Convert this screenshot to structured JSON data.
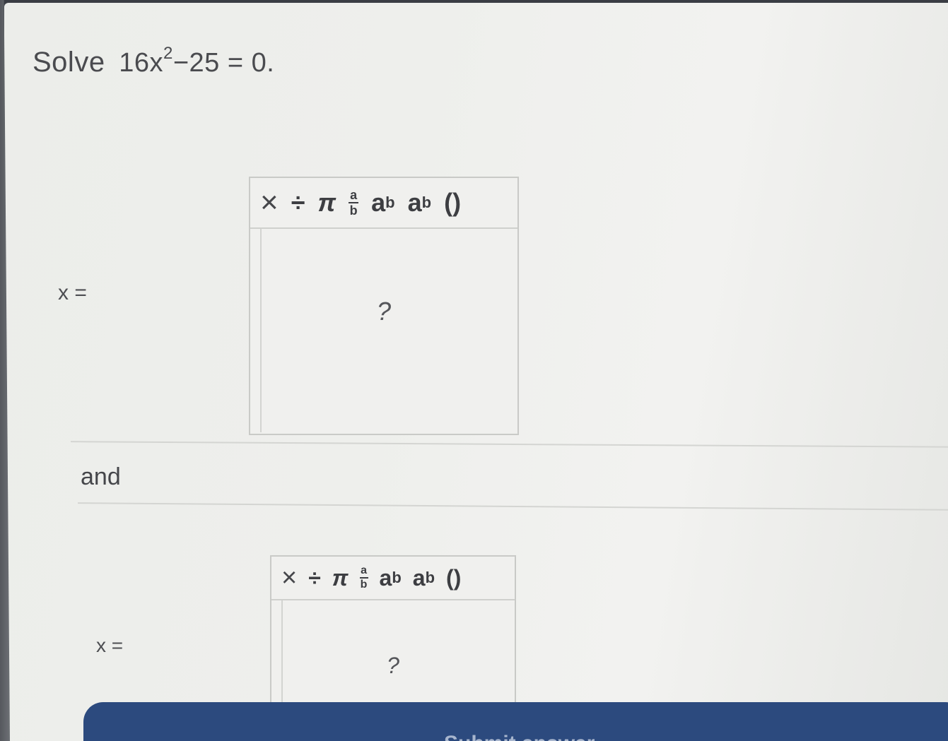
{
  "problem": {
    "prefix": "Solve",
    "coef": "16x",
    "exponent": "2",
    "rest": "−25 = 0."
  },
  "answer1": {
    "label": "x =",
    "placeholder": "?"
  },
  "answer2": {
    "label": "x =",
    "placeholder": "?"
  },
  "conjunction": "and",
  "toolbar": {
    "times": "×",
    "divide": "÷",
    "pi": "π",
    "frac_num": "a",
    "frac_den": "b",
    "power_base": "a",
    "power_exp": "b",
    "sub_base": "a",
    "sub_idx": "b",
    "parens": "()"
  },
  "submit": {
    "label": "Submit answer"
  },
  "colors": {
    "submit_bg": "#2c4a7e",
    "text": "#4a4b4f"
  }
}
